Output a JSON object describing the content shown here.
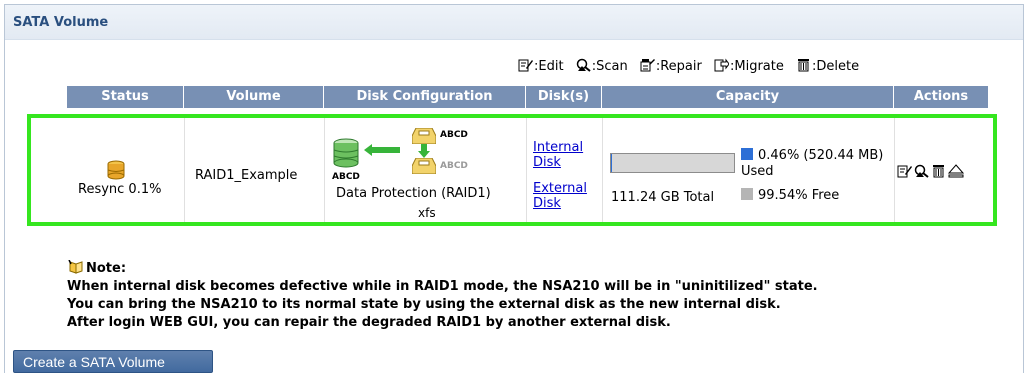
{
  "panel": {
    "title": "SATA Volume"
  },
  "legend": [
    {
      "icon": "edit-icon",
      "label": ":Edit"
    },
    {
      "icon": "scan-icon",
      "label": ":Scan"
    },
    {
      "icon": "repair-icon",
      "label": ":Repair"
    },
    {
      "icon": "migrate-icon",
      "label": ":Migrate"
    },
    {
      "icon": "delete-icon",
      "label": ":Delete"
    }
  ],
  "table": {
    "headers": [
      "Status",
      "Volume",
      "Disk Configuration",
      "Disk(s)",
      "Capacity",
      "Actions"
    ],
    "row": {
      "status": "Resync 0.1%",
      "volume": "RAID1_Example",
      "disk_config": {
        "disk_label_1": "ABCD",
        "disk_label_2": "ABCD",
        "disk_label_3": "ABCD",
        "mode": "Data Protection (RAID1)",
        "fs": "xfs"
      },
      "disks": [
        "Internal Disk",
        "External Disk"
      ],
      "capacity": {
        "total": "111.24 GB Total",
        "used": "0.46% (520.44 MB) Used",
        "free": "99.54% Free",
        "used_fraction": 0.0046
      },
      "actions": [
        "edit-icon",
        "scan-icon",
        "delete-icon",
        "eject-icon"
      ]
    }
  },
  "note": {
    "title": "Note:",
    "lines": [
      "When internal disk becomes defective while in RAID1 mode, the NSA210 will be in \"uninitilized\" state.",
      "You can bring the NSA210 to its normal state by using the external disk as the new internal disk.",
      "After login WEB GUI, you can repair the degraded RAID1 by another external disk."
    ]
  },
  "buttons": {
    "create": "Create a SATA Volume"
  },
  "colors": {
    "header": "#7890b4",
    "highlight": "#35e61f",
    "used": "#2d6fd6",
    "free": "#b5b5b5",
    "title": "#2a4f7f"
  }
}
